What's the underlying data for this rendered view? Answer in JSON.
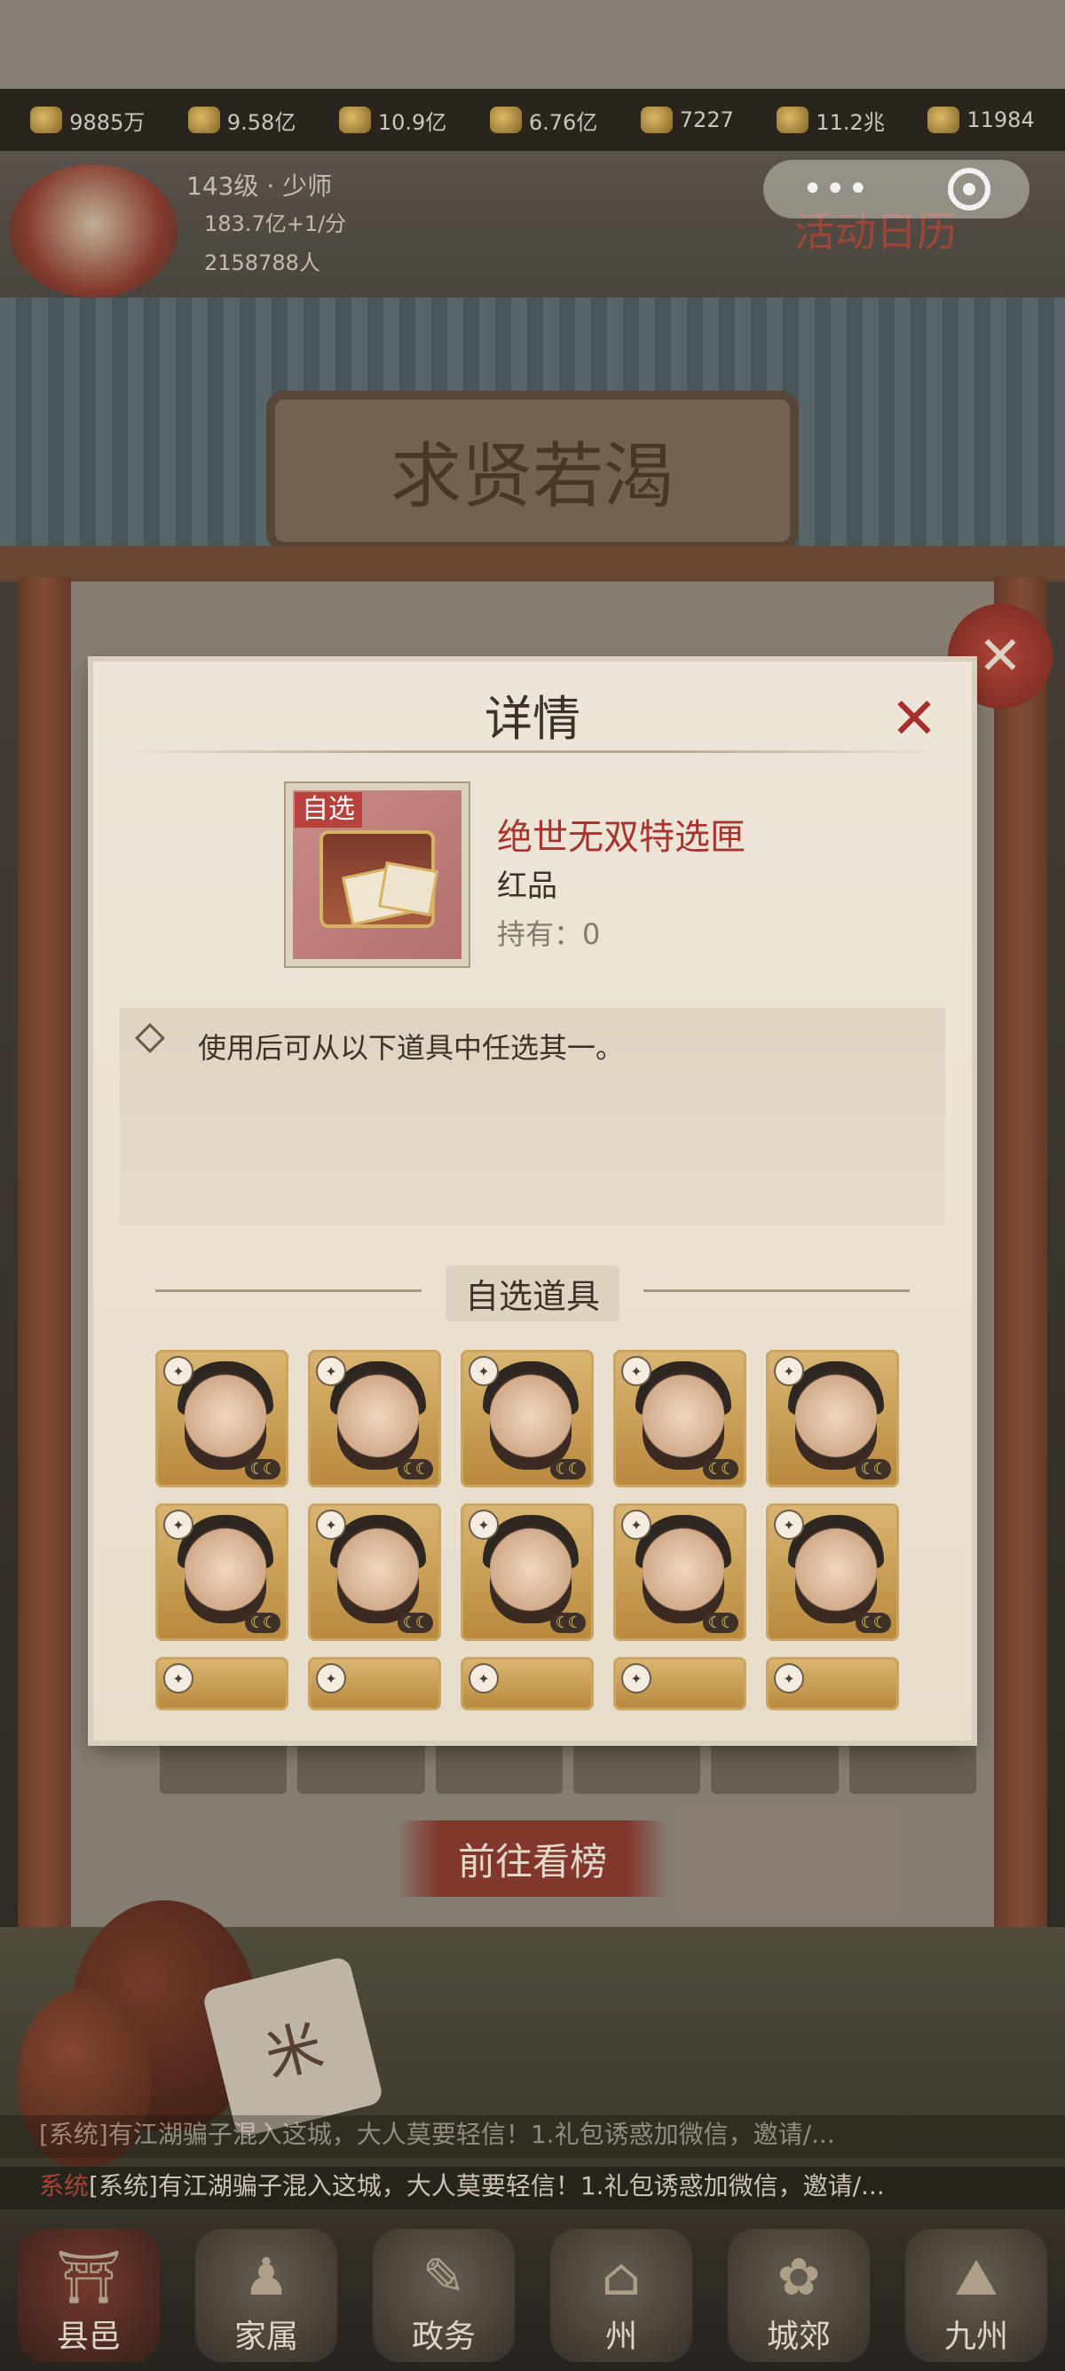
{
  "resources": [
    {
      "icon": "coin-icon",
      "value": "9885万"
    },
    {
      "icon": "gold-ingot-icon",
      "value": "9.58亿"
    },
    {
      "icon": "wood-icon",
      "value": "10.9亿"
    },
    {
      "icon": "grain-icon",
      "value": "6.76亿"
    },
    {
      "icon": "medal-icon",
      "value": "7227"
    },
    {
      "icon": "copper-coin-icon",
      "value": "11.2兆"
    },
    {
      "icon": "heart-icon",
      "value": "11984"
    }
  ],
  "player": {
    "level": "143级 · 少师",
    "income": "183.7亿+1/分",
    "population": "2158788人"
  },
  "miniprogram": {
    "menu_icon": "more-dots-icon",
    "close_icon": "target-circle-icon"
  },
  "event_tag": "活动日历",
  "building_sign": "求贤若渴",
  "go_button": "前往看榜",
  "bag": {
    "label": "米"
  },
  "chat": [
    {
      "tag": "系统",
      "text": "[系统]有江湖骗子混入这城，大人莫要轻信！1.礼包诱惑加微信，邀请/..."
    },
    {
      "tag": "系统",
      "text": "[系统]有江湖骗子混入这城，大人莫要轻信！1.礼包诱惑加微信，邀请/..."
    }
  ],
  "nav": [
    {
      "label": "县邑",
      "icon": "gate-icon"
    },
    {
      "label": "家属",
      "icon": "family-icon"
    },
    {
      "label": "政务",
      "icon": "scroll-icon"
    },
    {
      "label": "州",
      "icon": "palace-icon"
    },
    {
      "label": "城郊",
      "icon": "suburb-icon"
    },
    {
      "label": "九州",
      "icon": "map-icon"
    }
  ],
  "modal": {
    "title": "详情",
    "close_icon": "close-x-icon",
    "item": {
      "tag": "自选",
      "name": "绝世无双特选匣",
      "rarity": "红品",
      "own": "持有：0"
    },
    "description": "使用后可从以下道具中任选其一。",
    "section_label": "自选道具",
    "options_count_visible": 15
  },
  "colors": {
    "accent_red": "#a8342f",
    "title_brown": "#3e3128",
    "card_gold": "#c99c55"
  }
}
